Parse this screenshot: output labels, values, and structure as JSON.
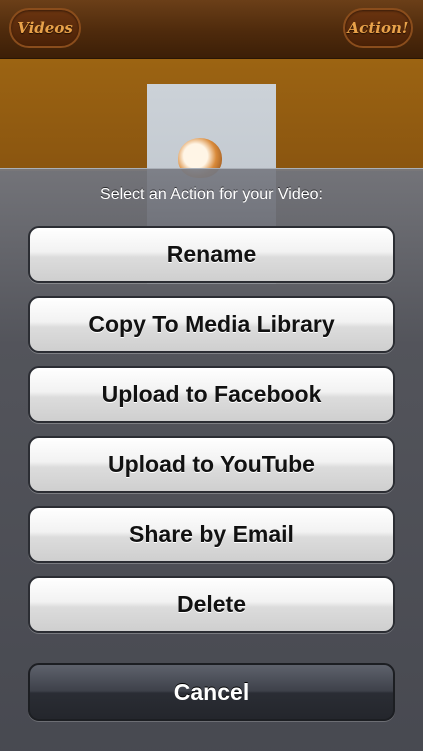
{
  "navbar": {
    "left_button": "Videos",
    "right_button": "Action!"
  },
  "action_sheet": {
    "title": "Select an Action for your Video:",
    "actions": [
      {
        "label": "Rename"
      },
      {
        "label": "Copy To Media Library"
      },
      {
        "label": "Upload to Facebook"
      },
      {
        "label": "Upload to YouTube"
      },
      {
        "label": "Share by Email"
      },
      {
        "label": "Delete"
      }
    ],
    "cancel": "Cancel"
  },
  "colors": {
    "navbar": "#4e2a0c",
    "nav_button_text": "#e9a24a",
    "sheet_background": "#54565e",
    "button_text": "#111111"
  }
}
